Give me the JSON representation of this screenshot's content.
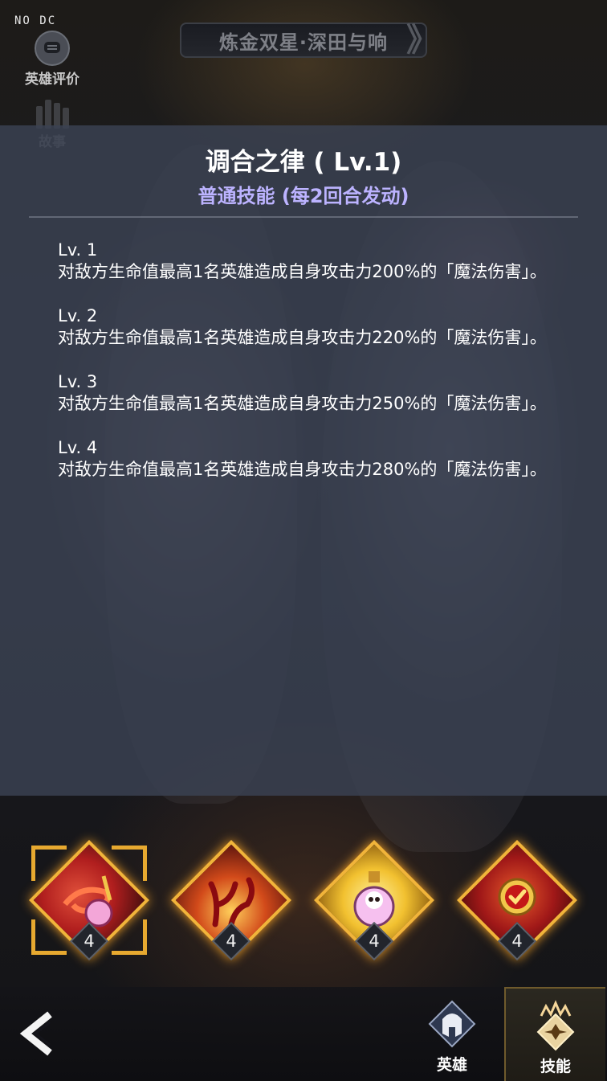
{
  "header": {
    "watermark": "NO DC",
    "hero_rating_label": "英雄评价",
    "story_label": "故事",
    "hero_title": "炼金双星·深田与响",
    "prev_arrow": "《",
    "next_arrow": "》"
  },
  "skill_detail": {
    "name": "调合之律 ( Lv.1)",
    "type": "普通技能 (每2回合发动)",
    "levels": [
      {
        "level": "Lv. 1",
        "description": "对敌方生命值最高1名英雄造成自身攻击力200%的「魔法伤害」。"
      },
      {
        "level": "Lv. 2",
        "description": "对敌方生命值最高1名英雄造成自身攻击力220%的「魔法伤害」。"
      },
      {
        "level": "Lv. 3",
        "description": "对敌方生命值最高1名英雄造成自身攻击力250%的「魔法伤害」。"
      },
      {
        "level": "Lv. 4",
        "description": "对敌方生命值最高1名英雄造成自身攻击力280%的「魔法伤害」。"
      }
    ]
  },
  "skills": [
    {
      "icon": "potion-swirl-icon",
      "level": "4",
      "selected": true
    },
    {
      "icon": "crimson-thorns-icon",
      "level": "4",
      "selected": false
    },
    {
      "icon": "skull-potion-icon",
      "level": "4",
      "selected": false
    },
    {
      "icon": "gold-checkmark-seal-icon",
      "level": "4",
      "selected": false
    }
  ],
  "bottom_nav": {
    "back_icon": "back-chevron-icon",
    "hero_label": "英雄",
    "skill_label": "技能",
    "active": "skill"
  },
  "colors": {
    "skill_type_text": "#bcb3ff",
    "frame_gold": "#f1b43a",
    "panel_bg": "#3a4252"
  }
}
